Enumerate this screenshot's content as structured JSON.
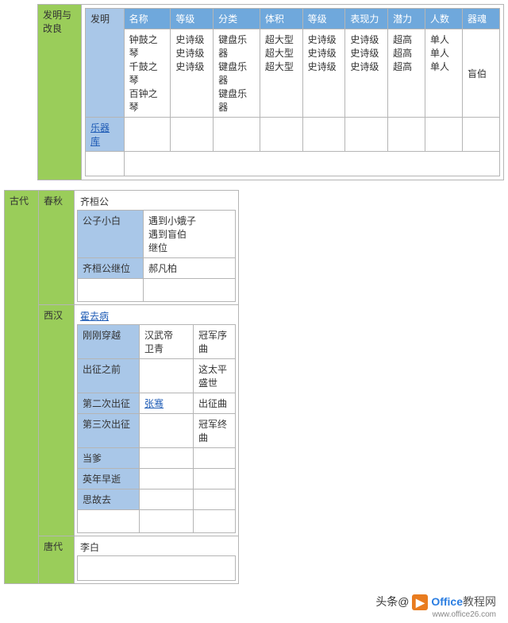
{
  "section1": {
    "rowLabel": "发明与改良",
    "invention": "发明",
    "link": "乐器库",
    "headers": [
      "名称",
      "等级",
      "分类",
      "体积",
      "等级",
      "表现力",
      "潜力",
      "人数",
      "器魂"
    ],
    "rows": [
      [
        "钟鼓之琴",
        "史诗级",
        "键盘乐器",
        "超大型",
        "史诗级",
        "史诗级",
        "超高",
        "单人",
        ""
      ],
      [
        "千鼓之琴",
        "史诗级",
        "键盘乐器",
        "超大型",
        "史诗级",
        "史诗级",
        "超高",
        "单人",
        "盲伯"
      ],
      [
        "百钟之琴",
        "史诗级",
        "键盘乐器",
        "超大型",
        "史诗级",
        "史诗级",
        "超高",
        "单人",
        ""
      ]
    ]
  },
  "gudai": "古代",
  "chunqiu": {
    "label": "春秋",
    "title": "齐桓公",
    "sub1_label": "公子小白",
    "sub1_items": [
      "遇到小娥子",
      "遇到盲伯",
      "继位"
    ],
    "sub2_label": "齐桓公继位",
    "sub2_value": "郝凡柏"
  },
  "xihan": {
    "label": "西汉",
    "link": "霍去病",
    "rows": [
      {
        "c1": "刚刚穿越",
        "c2": "汉武帝\n卫青",
        "c3": "冠军序曲"
      },
      {
        "c1": "出征之前",
        "c2": "",
        "c3": "这太平盛世"
      },
      {
        "c1": "第二次出征",
        "c2_link": "张骞",
        "c3": "出征曲"
      },
      {
        "c1": "第三次出征",
        "c2": "",
        "c3": "冠军终曲"
      },
      {
        "c1": "当爹",
        "c2": "",
        "c3": ""
      },
      {
        "c1": "英年早逝",
        "c2": "",
        "c3": ""
      },
      {
        "c1": "思故去",
        "c2": "",
        "c3": ""
      }
    ]
  },
  "tangdai": {
    "label": "唐代",
    "title": "李白"
  },
  "footer": {
    "prefix": "头条@",
    "brand1": "Office",
    "brand2": "教程网",
    "url": "www.office26.com"
  }
}
